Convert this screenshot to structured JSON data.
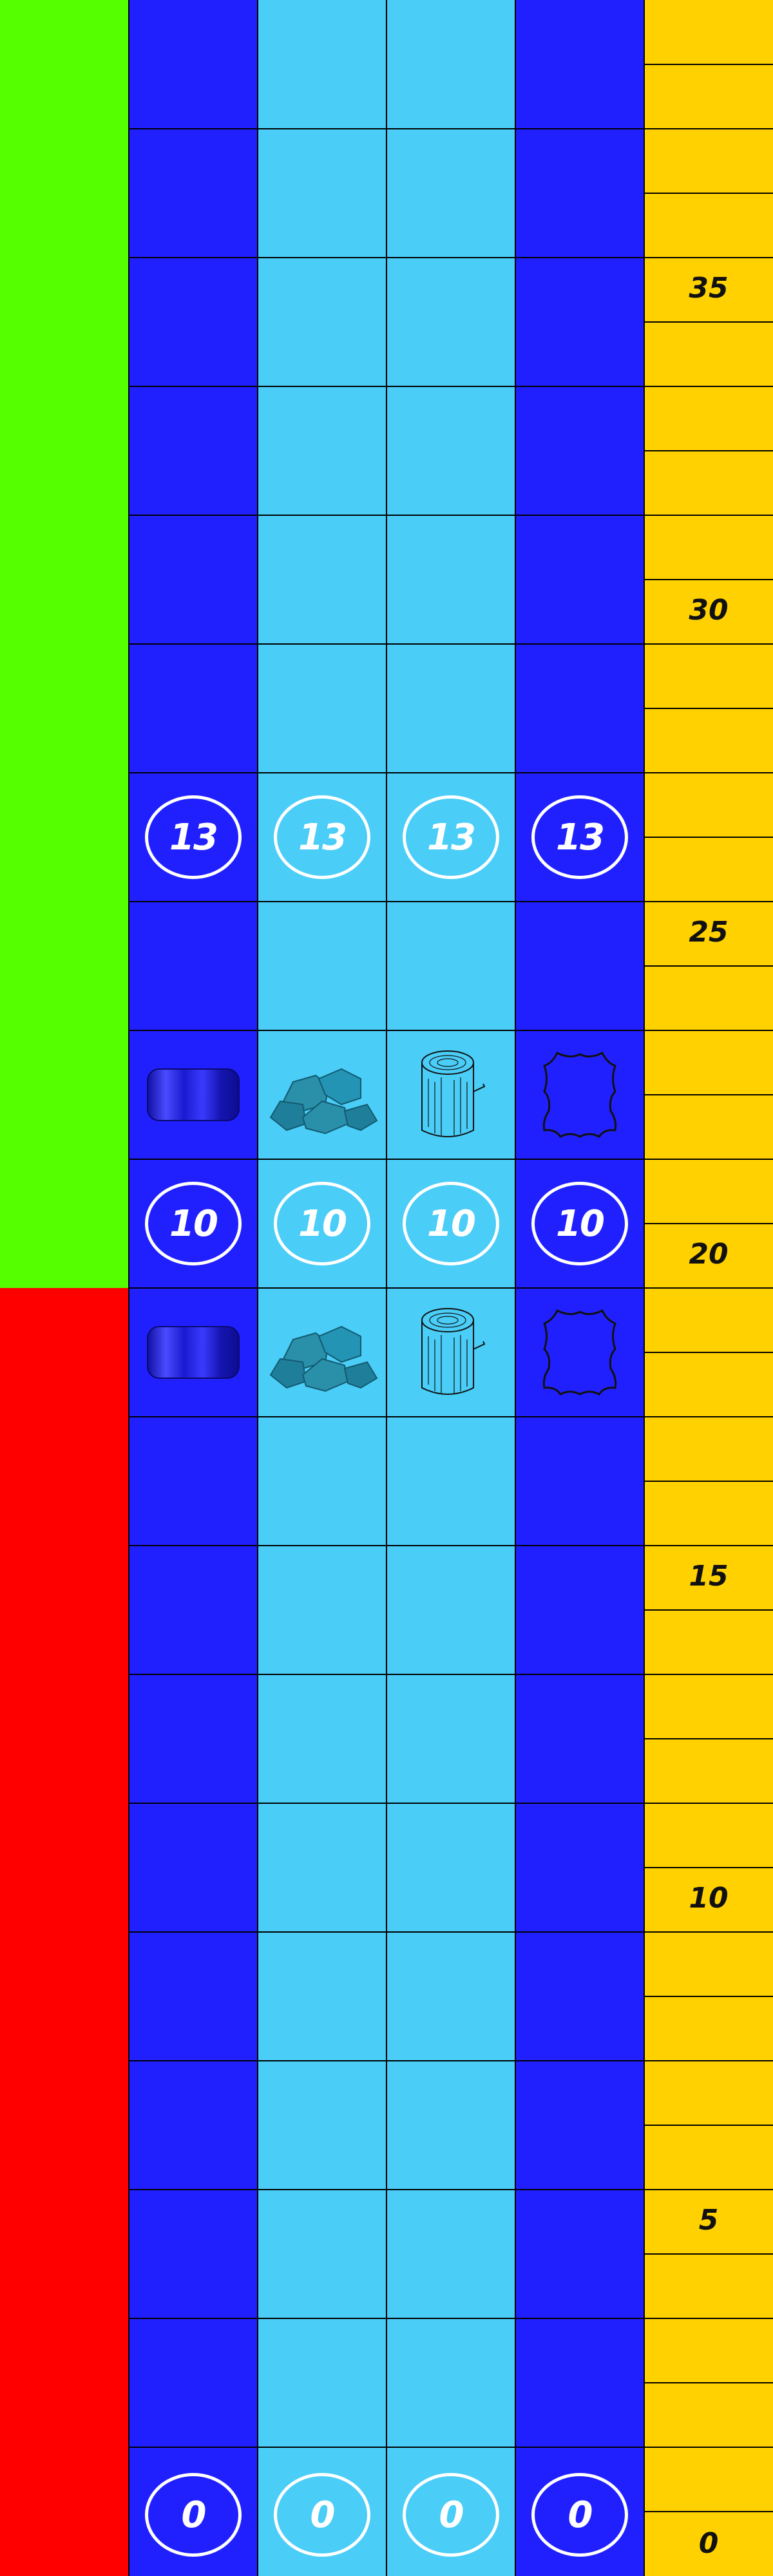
{
  "board": {
    "zones": [
      {
        "name": "upper-zone",
        "color": "#55ff00"
      },
      {
        "name": "lower-zone",
        "color": "#ff0000"
      }
    ],
    "columns": [
      {
        "name": "cloth",
        "color": "#2020ff",
        "icon": "cloth-bolt-icon"
      },
      {
        "name": "stone",
        "color": "#4acdf7",
        "icon": "stone-pile-icon"
      },
      {
        "name": "wood",
        "color": "#4acdf7",
        "icon": "wood-log-icon"
      },
      {
        "name": "leather",
        "color": "#2020ff",
        "icon": "leather-hide-icon"
      }
    ],
    "scale_color": "#ffd100",
    "badges": {
      "row13": [
        "13",
        "13",
        "13",
        "13"
      ],
      "row10": [
        "10",
        "10",
        "10",
        "10"
      ],
      "row0": [
        "0",
        "0",
        "0",
        "0"
      ]
    },
    "scale_labels": [
      "0",
      "5",
      "10",
      "15",
      "20",
      "25",
      "30",
      "35"
    ]
  }
}
